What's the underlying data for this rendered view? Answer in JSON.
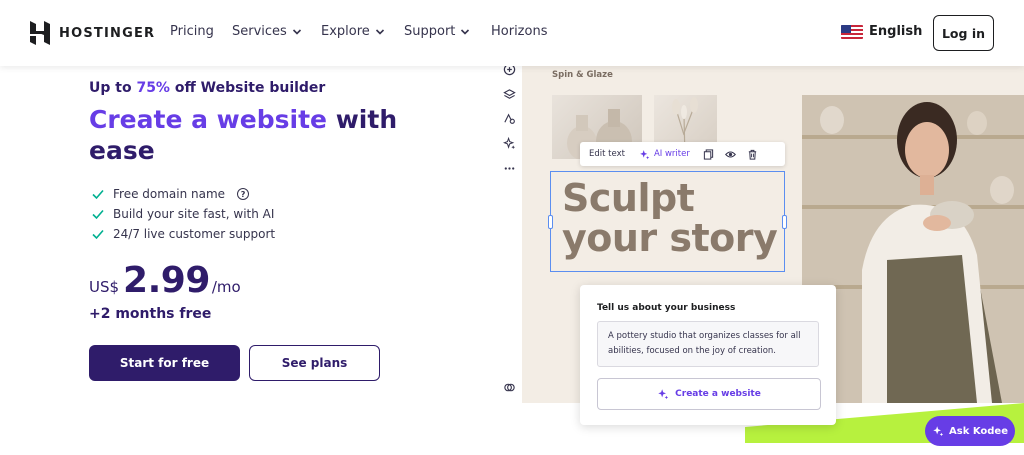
{
  "header": {
    "brand": "HOSTINGER",
    "nav": [
      {
        "label": "Pricing",
        "dropdown": false
      },
      {
        "label": "Services",
        "dropdown": true
      },
      {
        "label": "Explore",
        "dropdown": true
      },
      {
        "label": "Support",
        "dropdown": true
      },
      {
        "label": "Horizons",
        "dropdown": false
      }
    ],
    "language": "English",
    "login_label": "Log in"
  },
  "hero": {
    "promo_prefix": "Up to ",
    "promo_percent": "75%",
    "promo_suffix": " off Website builder",
    "title_accent": "Create a website",
    "title_rest": " with ease",
    "features": [
      "Free domain name",
      "Build your site fast, with AI",
      "24/7 live customer support"
    ],
    "currency": "US$",
    "price": "2.99",
    "period": "/mo",
    "bonus": "+2 months free",
    "primary_cta": "Start for free",
    "secondary_cta": "See plans"
  },
  "builder": {
    "site_name": "Spin & Glaze",
    "edit_text_label": "Edit text",
    "ai_writer_label": "AI writer",
    "headline_line1": "Sculpt",
    "headline_line2": "your story",
    "prompt_title": "Tell us about your business",
    "prompt_text": "A pottery studio that organizes classes for all abilities, focused on the joy of creation.",
    "create_button": "Create a website"
  },
  "chat": {
    "label": "Ask Kodee"
  },
  "colors": {
    "brand_dark": "#2f1c6a",
    "brand_purple": "#673de6",
    "check_green": "#00b090",
    "lime": "#b7f13e"
  }
}
